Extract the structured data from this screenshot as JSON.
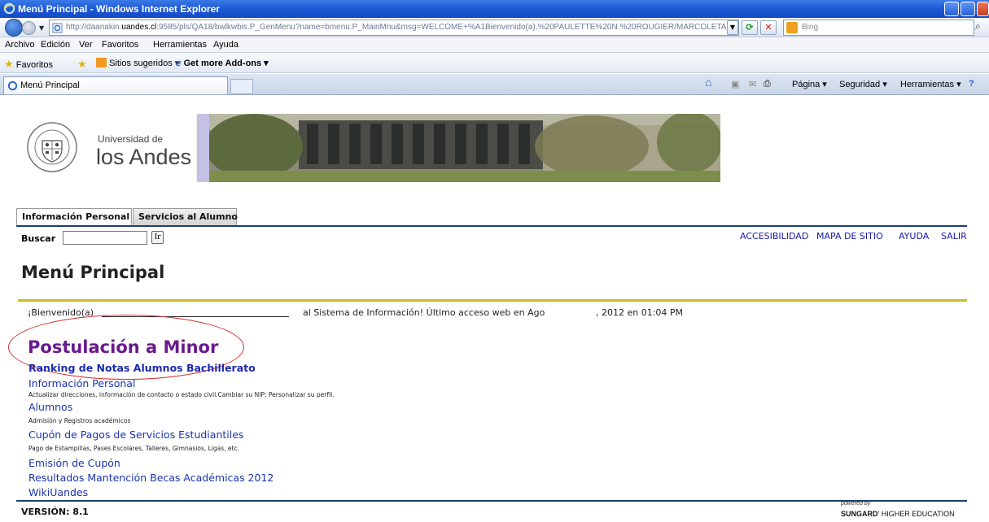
{
  "window": {
    "title": "Menú Principal - Windows Internet Explorer"
  },
  "address": {
    "url_prefix": "http://daanakin.",
    "url_host": "uandes.cl",
    "url_rest": ":9585/pls/QA18/bwlkwbis.P_GenMenu?name=bmenu.P_MainMnu&msg=WELCOME+%A1Bienvenido(a),%20PAULETTE%20N.%20ROUGIER/MARCOLETA,",
    "search_placeholder": "Bing"
  },
  "menubar": [
    "Archivo",
    "Edición",
    "Ver",
    "Favoritos",
    "Herramientas",
    "Ayuda"
  ],
  "favorites": {
    "label": "Favoritos",
    "sugeridos": "Sitios sugeridos ▾",
    "addons": "Get more Add-ons ▾"
  },
  "ie_tab": {
    "label": "Menú Principal"
  },
  "commandbar": {
    "pagina": "Página ▾",
    "seguridad": "Seguridad ▾",
    "herramientas": "Herramientas ▾"
  },
  "brand": {
    "line1": "Universidad de",
    "line2": "los Andes"
  },
  "page_tabs": [
    "Información Personal",
    "Servicios al Alumno"
  ],
  "search": {
    "label": "Buscar",
    "value": "",
    "go_label": "Ir"
  },
  "toplinks": [
    "ACCESIBILIDAD",
    "MAPA DE SITIO",
    "AYUDA",
    "SALIR"
  ],
  "page_title": "Menú Principal",
  "welcome": {
    "start": "¡Bienvenido(a)",
    "middle": "al Sistema de Información! Último acceso web en Ago",
    "end": ", 2012 en 01:04 PM"
  },
  "menu": {
    "minor": "Postulación a Minor",
    "ranking": "Ranking de Notas Alumnos Bachillerato",
    "items": [
      {
        "label": "Información Personal",
        "desc": "Actualizar direcciones, información de contacto o estado civil.Cambiar su NIP; Personalizar su perfil."
      },
      {
        "label": "Alumnos",
        "desc": "Admisión y Registros académicos"
      },
      {
        "label": "Cupón de Pagos de Servicios Estudiantiles",
        "desc": "Pago de Estampillas, Pases Escolares, Talleres, Gimnasios, Ligas, etc."
      },
      {
        "label": "Emisión de Cupón",
        "desc": ""
      },
      {
        "label": "Resultados Mantención Becas Académicas 2012",
        "desc": ""
      },
      {
        "label": "WikiUandes",
        "desc": ""
      }
    ]
  },
  "footer": {
    "version": "VERSIÓN: 8.1",
    "powered": "powered by",
    "sungard_bold": "SUNGARD",
    "sungard_rest": "' HIGHER EDUCATION"
  }
}
